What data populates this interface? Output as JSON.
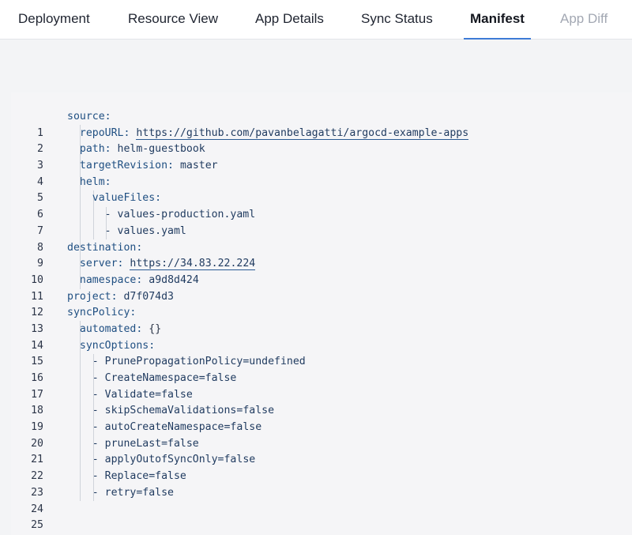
{
  "tabs": [
    {
      "label": "Deployment",
      "state": "normal"
    },
    {
      "label": "Resource View",
      "state": "normal"
    },
    {
      "label": "App Details",
      "state": "normal"
    },
    {
      "label": "Sync Status",
      "state": "normal"
    },
    {
      "label": "Manifest",
      "state": "active"
    },
    {
      "label": "App Diff",
      "state": "disabled"
    }
  ],
  "manifest": {
    "line_numbers": [
      "1",
      "2",
      "3",
      "4",
      "5",
      "6",
      "7",
      "8",
      "9",
      "10",
      "11",
      "12",
      "13",
      "14",
      "15",
      "16",
      "17",
      "18",
      "19",
      "20",
      "21",
      "22",
      "23",
      "24",
      "25"
    ],
    "source_key": "source:",
    "repo_url_key": "repoURL:",
    "repo_url_value": "https://github.com/pavanbelagatti/argocd-example-apps",
    "path_key": "path:",
    "path_value": "helm-guestbook",
    "target_revision_key": "targetRevision:",
    "target_revision_value": "master",
    "helm_key": "helm:",
    "value_files_key": "valueFiles:",
    "value_files": [
      "- values-production.yaml",
      "- values.yaml"
    ],
    "destination_key": "destination:",
    "server_key": "server:",
    "server_value": "https://34.83.22.224",
    "namespace_key": "namespace:",
    "namespace_value": "a9d8d424",
    "project_key": "project:",
    "project_value": "d7f074d3",
    "sync_policy_key": "syncPolicy:",
    "automated_key": "automated:",
    "automated_value": "{}",
    "sync_options_key": "syncOptions:",
    "sync_options": [
      "- PrunePropagationPolicy=undefined",
      "- CreateNamespace=false",
      "- Validate=false",
      "- skipSchemaValidations=false",
      "- autoCreateNamespace=false",
      "- pruneLast=false",
      "- applyOutofSyncOnly=false",
      "- Replace=false",
      "- retry=false"
    ]
  },
  "colors": {
    "accent": "#3e7bd6",
    "disabled_tab": "#a3a8b3",
    "editor_bg": "#f5f5f7",
    "key_text": "#1f4f82"
  }
}
